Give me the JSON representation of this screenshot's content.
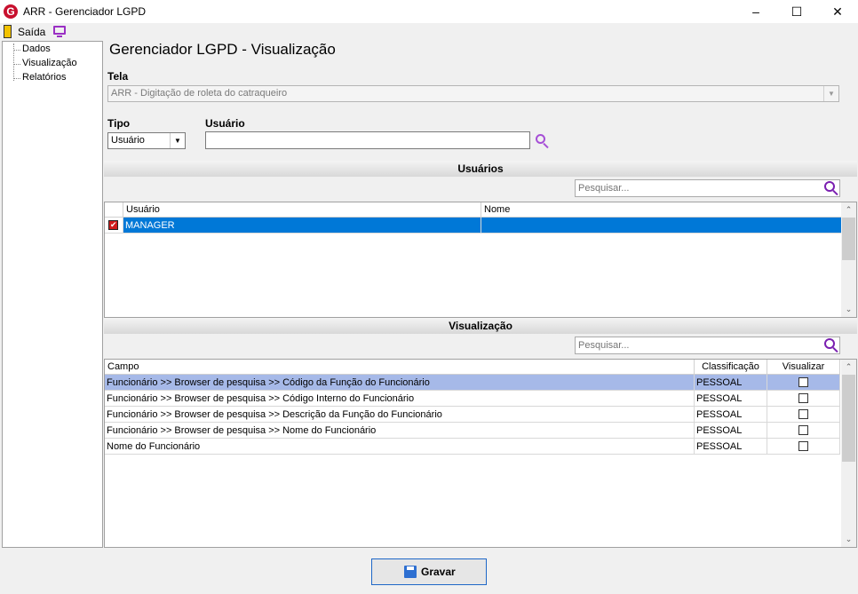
{
  "window": {
    "title": "ARR - Gerenciador LGPD",
    "logo_letter": "G",
    "minimize_glyph": "‒",
    "maximize_glyph": "☐",
    "close_glyph": "✕"
  },
  "toolbar": {
    "exit_label": "Saída"
  },
  "tree": {
    "items": [
      {
        "label": "Dados"
      },
      {
        "label": "Visualização"
      },
      {
        "label": "Relatórios"
      }
    ]
  },
  "main": {
    "page_title": "Gerenciador LGPD - Visualização",
    "screen_label": "Tela",
    "screen_value": "ARR - Digitação de roleta do catraqueiro",
    "type_label": "Tipo",
    "type_value": "Usuário",
    "user_label": "Usuário",
    "user_value": ""
  },
  "users_section": {
    "title": "Usuários",
    "search_placeholder": "Pesquisar...",
    "columns": [
      "Usuário",
      "Nome"
    ],
    "rows": [
      {
        "checked": true,
        "user": "MANAGER",
        "name": ""
      }
    ]
  },
  "view_section": {
    "title": "Visualização",
    "search_placeholder": "Pesquisar...",
    "columns": [
      "Campo",
      "Classificação",
      "Visualizar"
    ],
    "rows": [
      {
        "field": "Funcionário >> Browser de pesquisa >> Código da Função do Funcionário",
        "classification": "PESSOAL",
        "visible": false
      },
      {
        "field": "Funcionário >> Browser de pesquisa >> Código Interno do Funcionário",
        "classification": "PESSOAL",
        "visible": false
      },
      {
        "field": "Funcionário >> Browser de pesquisa >> Descrição da Função do Funcionário",
        "classification": "PESSOAL",
        "visible": false
      },
      {
        "field": "Funcionário >> Browser de pesquisa >> Nome do Funcionário",
        "classification": "PESSOAL",
        "visible": false
      },
      {
        "field": "Nome do Funcionário",
        "classification": "PESSOAL",
        "visible": false
      }
    ]
  },
  "footer": {
    "save_label": "Gravar"
  },
  "colors": {
    "selection_blue": "#0078d7",
    "row_highlight": "#a6b9e8",
    "icon_purple": "#a64fd6",
    "logo_red": "#c8102e"
  }
}
